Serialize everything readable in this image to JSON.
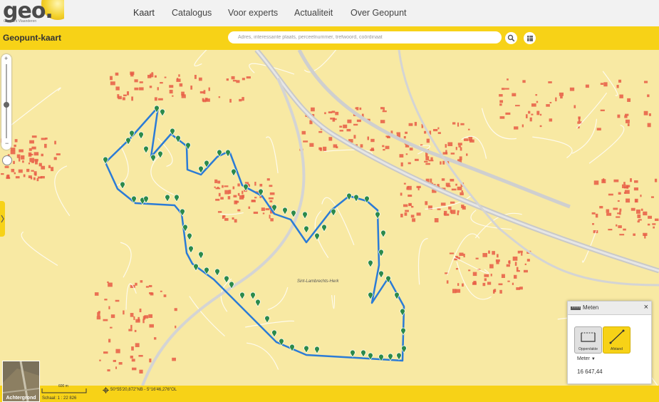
{
  "logo": {
    "text": "geo.",
    "subtitle": "Geopunt Vlaanderen"
  },
  "nav": {
    "items": [
      "Kaart",
      "Catalogus",
      "Voor experts",
      "Actualiteit",
      "Over Geopunt"
    ],
    "active": "Kaart"
  },
  "title": "Geopunt-kaart",
  "search": {
    "placeholder": "Adres, interessante plaats, perceelnummer, trefwoord, coördinaat",
    "value": ""
  },
  "map": {
    "place_label": "Sint-Lambrechts-Herk"
  },
  "measure": {
    "title": "Meten",
    "close": "×",
    "tools": [
      {
        "label": "Oppervlakte",
        "icon": "area-icon"
      },
      {
        "label": "Afstand",
        "icon": "distance-icon",
        "active": true
      }
    ],
    "unit": "Meter",
    "value": "16 647,44"
  },
  "footer": {
    "background_label": "Achtergrond",
    "scale_bar": "600 m",
    "scale": "Schaal: 1 : 22 826",
    "coordinates": "50°55'20,872\"NB - 5°16'46,276\"OL"
  },
  "colors": {
    "accent": "#f7d217",
    "route": "#2b7bd6",
    "marker": "#2c8a4a",
    "map_bg": "#f8e9a3",
    "buildings": "#e85c45"
  }
}
